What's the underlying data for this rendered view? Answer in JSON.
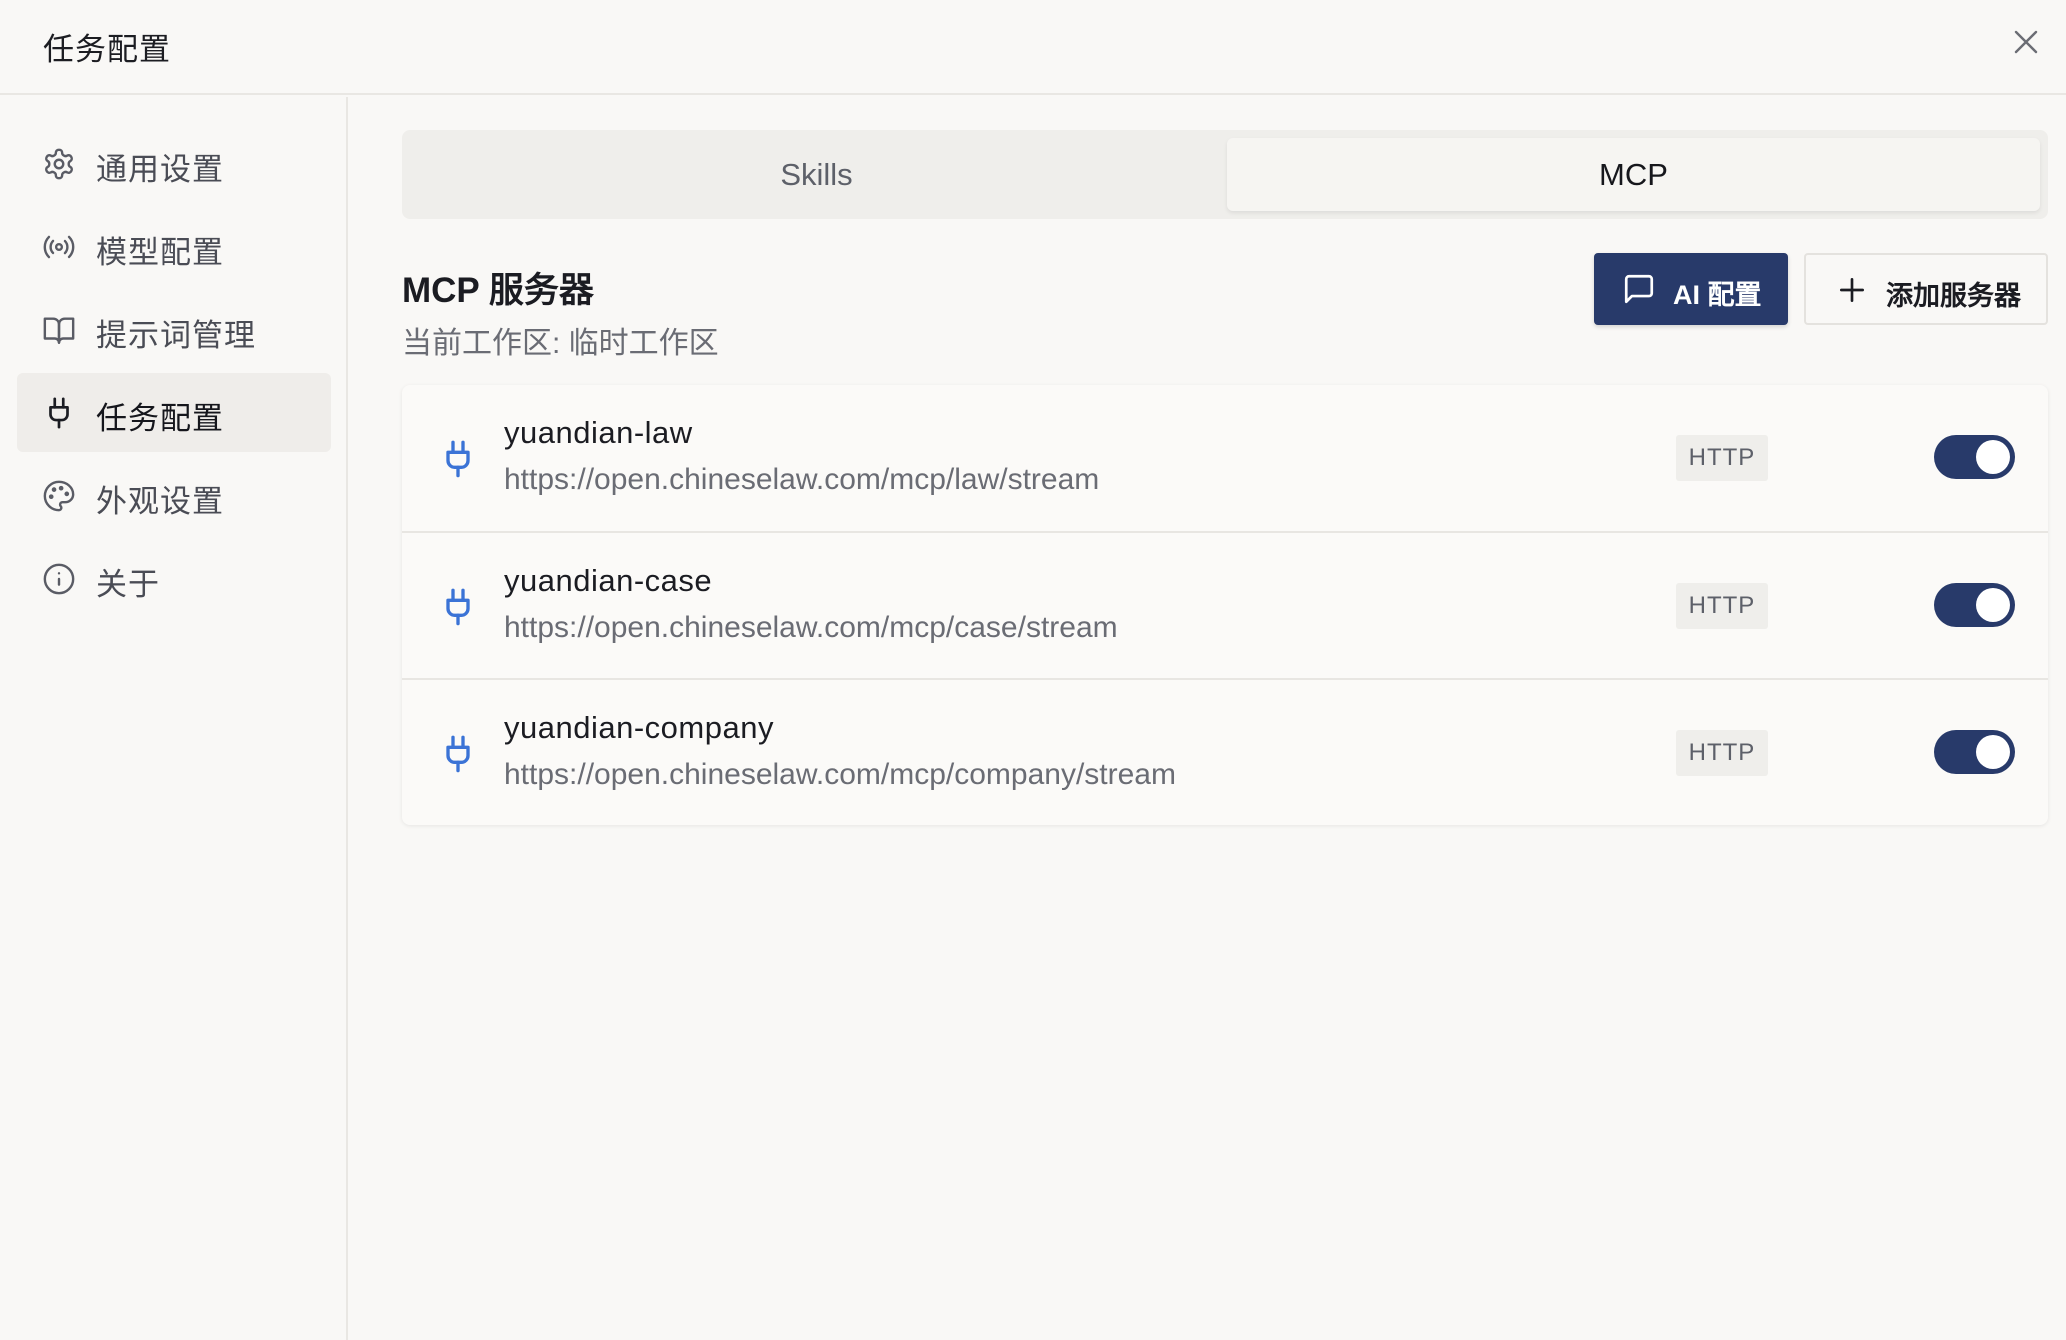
{
  "window": {
    "title": "任务配置"
  },
  "sidebar": {
    "items": [
      {
        "label": "通用设置",
        "icon": "gear-icon"
      },
      {
        "label": "模型配置",
        "icon": "broadcast-icon"
      },
      {
        "label": "提示词管理",
        "icon": "book-icon"
      },
      {
        "label": "任务配置",
        "icon": "plug-icon",
        "active": true
      },
      {
        "label": "外观设置",
        "icon": "palette-icon"
      },
      {
        "label": "关于",
        "icon": "info-icon"
      }
    ]
  },
  "tabs": [
    {
      "label": "Skills",
      "selected": false
    },
    {
      "label": "MCP",
      "selected": true
    }
  ],
  "section": {
    "title": "MCP 服务器",
    "workspace": "当前工作区: 临时工作区",
    "ai_button": "AI 配置",
    "add_button": "添加服务器"
  },
  "servers": [
    {
      "name": "yuandian-law",
      "url": "https://open.chineselaw.com/mcp/law/stream",
      "transport": "HTTP",
      "enabled": true
    },
    {
      "name": "yuandian-case",
      "url": "https://open.chineselaw.com/mcp/case/stream",
      "transport": "HTTP",
      "enabled": true
    },
    {
      "name": "yuandian-company",
      "url": "https://open.chineselaw.com/mcp/company/stream",
      "transport": "HTTP",
      "enabled": true
    }
  ],
  "colors": {
    "accent": "#283a6a",
    "plug_icon": "#3b73d6",
    "background": "#f9f8f6"
  }
}
